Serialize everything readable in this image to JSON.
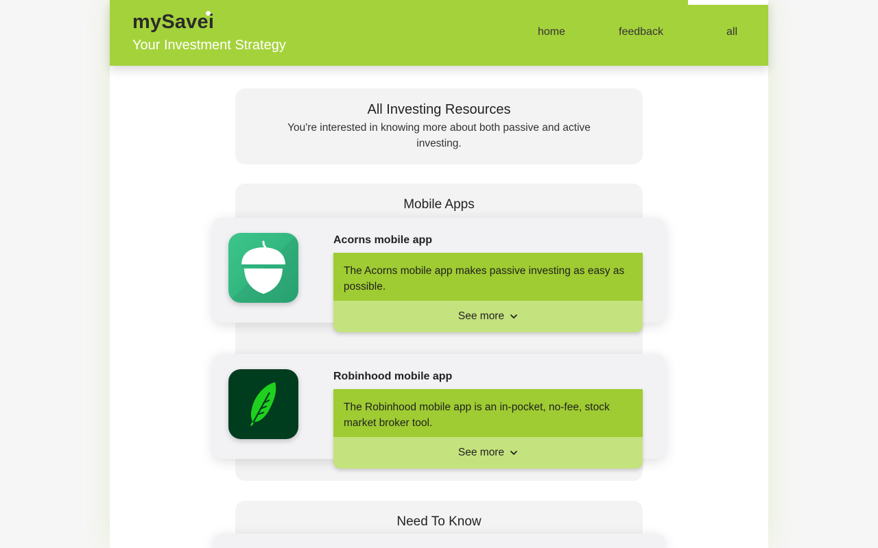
{
  "header": {
    "brand": "mySavei",
    "tagline": "Your Investment Strategy",
    "nav": [
      {
        "label": "home"
      },
      {
        "label": "feedback"
      },
      {
        "label": "all"
      }
    ],
    "colors": {
      "accent": "#a4d23b",
      "desc_bg": "#9fcc32",
      "see_more_bg": "#c4e27e"
    }
  },
  "intro": {
    "title": "All Investing Resources",
    "description": "You're interested in knowing more about both passive and active investing."
  },
  "mobile_apps": {
    "title": "Mobile Apps",
    "apps": [
      {
        "name": "Acorns mobile app",
        "description": "The Acorns mobile app makes passive investing as easy as possible.",
        "see_more": "See more",
        "icon": "acorn-icon"
      },
      {
        "name": "Robinhood mobile app",
        "description": "The Robinhood mobile app is an in-pocket, no-fee, stock market broker tool.",
        "see_more": "See more",
        "icon": "feather-icon"
      }
    ]
  },
  "need_to_know": {
    "title": "Need To Know"
  }
}
